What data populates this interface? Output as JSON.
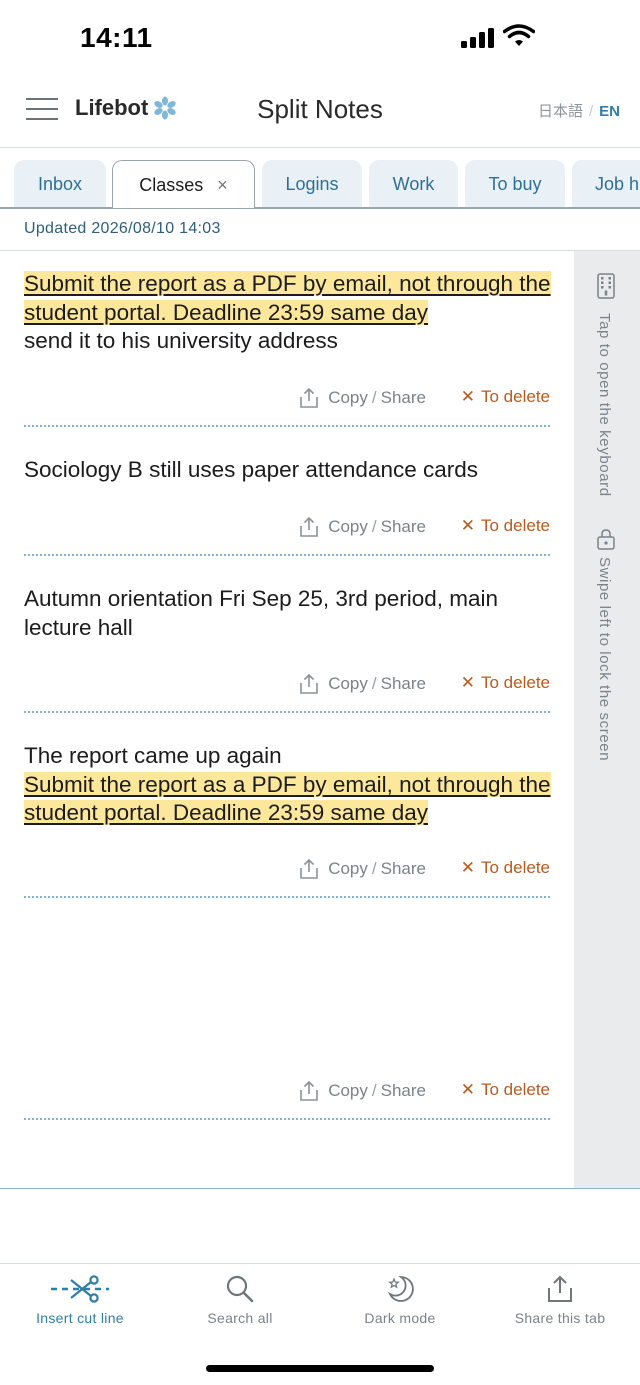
{
  "status_bar": {
    "time": "14:11"
  },
  "header": {
    "brand": "Lifebot",
    "title": "Split Notes",
    "lang_ja": "日本語",
    "lang_sep": "/",
    "lang_en": "EN"
  },
  "tabs": [
    {
      "label": "Inbox"
    },
    {
      "label": "Classes",
      "active": true,
      "close": "×"
    },
    {
      "label": "Logins"
    },
    {
      "label": "Work"
    },
    {
      "label": "To buy"
    },
    {
      "label": "Job h"
    }
  ],
  "updated": "Updated 2026/08/10 14:03",
  "side_rail": {
    "keyboard_hint": "Tap to open the keyboard",
    "lock_hint": "Swipe left to lock the screen"
  },
  "actions": {
    "copy": "Copy",
    "slash": "/",
    "share": "Share",
    "delete": "To delete",
    "delete_mark": "✕"
  },
  "notes": [
    {
      "highlight": "Submit the report as a PDF by email, not through the student portal. Deadline 23:59 same day",
      "text": "send it to his university address"
    },
    {
      "text": "Sociology B still uses paper attendance cards"
    },
    {
      "text": "Autumn orientation Fri Sep 25, 3rd period, main lecture hall"
    },
    {
      "text": "The report came up again",
      "highlight": "Submit the report as a PDF by email, not through the student portal. Deadline 23:59 same day"
    },
    {
      "text": ""
    }
  ],
  "tabbar": [
    {
      "label": "Insert cut line",
      "icon": "scissors-cut-line-icon",
      "active": true
    },
    {
      "label": "Search all",
      "icon": "search-icon"
    },
    {
      "label": "Dark mode",
      "icon": "moon-star-icon"
    },
    {
      "label": "Share this tab",
      "icon": "share-icon"
    }
  ],
  "colors": {
    "accent": "#2f7ea6",
    "highlight": "#fde79b",
    "delete": "#b85b1f",
    "tab_bg": "#e9f1f6",
    "rail_bg": "#e9ebec"
  }
}
